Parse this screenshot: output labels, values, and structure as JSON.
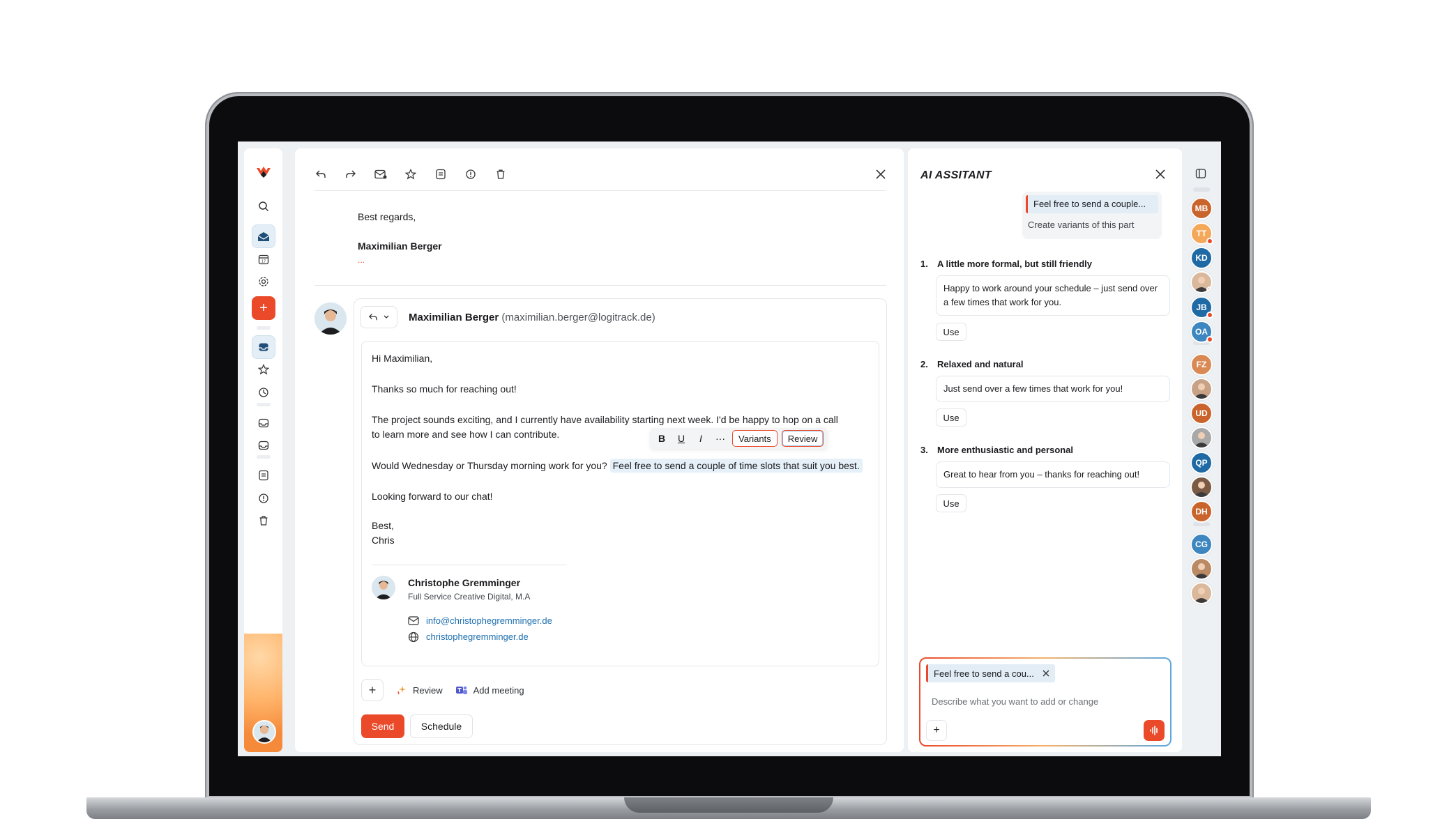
{
  "colors": {
    "accent": "#ea4a2a",
    "highlight": "#e5f0f8",
    "link": "#1e6fb0"
  },
  "quoted": {
    "closing": "Best regards,",
    "name": "Maximilian Berger",
    "ellipsis": "..."
  },
  "compose": {
    "sender_name": "Maximilian Berger",
    "sender_email": "(maximilian.berger@logitrack.de)",
    "greeting": "Hi Maximilian,",
    "line1": "Thanks so much for reaching out!",
    "line2a": "The project sounds exciting, and I currently have availability starting next week. I'd be happy to hop on a call",
    "line2b": "to learn more and see how I can contribute.",
    "line3_plain": "Would Wednesday or Thursday morning work for you?",
    "line3_highlight": "Feel free to send a couple of time slots that suit you best.",
    "line4": "Looking forward to our chat!",
    "signoff": "Best,",
    "signoff_name": "Chris",
    "format_bar": {
      "bold": "B",
      "underline": "U",
      "italic": "I",
      "more": "···",
      "variants": "Variants",
      "review": "Review"
    },
    "signature": {
      "name": "Christophe Gremminger",
      "role": "Full Service Creative Digital, M.A",
      "email": "info@christophegremminger.de",
      "website": "christophegremminger.de"
    },
    "actions": {
      "review": "Review",
      "add_meeting": "Add meeting"
    },
    "send": "Send",
    "schedule": "Schedule"
  },
  "ai": {
    "title": "AI ASSITANT",
    "context_quote": "Feel free to send a couple...",
    "context_request": "Create variants of this part",
    "variants": [
      {
        "num": "1.",
        "title": "A little more formal, but still friendly",
        "text": "Happy to work around your schedule – just send over a few times that work for you.",
        "use": "Use"
      },
      {
        "num": "2.",
        "title": "Relaxed and natural",
        "text": "Just send over a few times that work for you!",
        "use": "Use"
      },
      {
        "num": "3.",
        "title": "More enthusiastic and personal",
        "text": "Great to hear from you – thanks for reaching out!",
        "use": "Use"
      }
    ],
    "chip": "Feel free to send a cou...",
    "placeholder": "Describe what you want to add or change"
  },
  "contacts": [
    {
      "initials": "MB",
      "color": "#c9652c",
      "dot": false
    },
    {
      "initials": "TT",
      "color": "#f4a85a",
      "dot": true
    },
    {
      "initials": "KD",
      "color": "#1f6aa5",
      "dot": false
    },
    {
      "initials": "",
      "color": "#d9b89c",
      "dot": true
    },
    {
      "initials": "JB",
      "color": "#1f6aa5",
      "dot": true
    },
    {
      "initials": "OA",
      "color": "#3d86bf",
      "dot": true
    },
    {
      "initials": "FZ",
      "color": "#d98a54",
      "dot": false
    },
    {
      "initials": "",
      "color": "#c7a286",
      "dot": false
    },
    {
      "initials": "UD",
      "color": "#c9652c",
      "dot": false
    },
    {
      "initials": "",
      "color": "#a9a9a9",
      "dot": false
    },
    {
      "initials": "QP",
      "color": "#1f6aa5",
      "dot": false
    },
    {
      "initials": "",
      "color": "#7a5a45",
      "dot": false
    },
    {
      "initials": "DH",
      "color": "#c9652c",
      "dot": false
    },
    {
      "initials": "CG",
      "color": "#3d86bf",
      "dot": false
    },
    {
      "initials": "",
      "color": "#b98a64",
      "dot": false
    },
    {
      "initials": "",
      "color": "#d9b89c",
      "dot": false
    }
  ]
}
